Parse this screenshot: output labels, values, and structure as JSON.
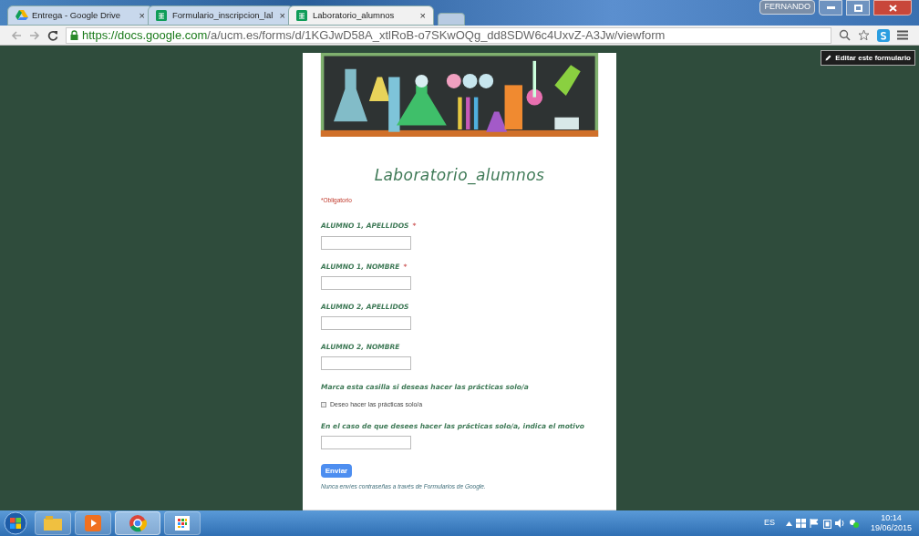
{
  "browser": {
    "tabs": [
      {
        "title": "Entrega - Google Drive",
        "selected": false,
        "close": "×"
      },
      {
        "title": "Formulario_inscripcion_lal",
        "selected": false,
        "close": "×"
      },
      {
        "title": "Laboratorio_alumnos",
        "selected": true,
        "close": "×"
      }
    ],
    "user": "FERNANDO",
    "url": {
      "host": "https://docs.google.com",
      "path": "/a/ucm.es/forms/d/1KGJwD58A_xtlRoB-o7SKwOQg_dd8SDW6c4UxvZ-A3Jw/viewform"
    }
  },
  "edit_button": "Editar este formulario",
  "form": {
    "title": "Laboratorio_alumnos",
    "required_note": "*Obligatorio",
    "required_mark": "*",
    "questions": [
      {
        "kind": "text",
        "label": "ALUMNO 1, APELLIDOS",
        "required": true
      },
      {
        "kind": "text",
        "label": "ALUMNO 1, NOMBRE",
        "required": true
      },
      {
        "kind": "text",
        "label": "ALUMNO 2, APELLIDOS",
        "required": false
      },
      {
        "kind": "text",
        "label": "ALUMNO 2, NOMBRE",
        "required": false
      },
      {
        "kind": "checkbox",
        "label": "Marca esta casilla si deseas hacer las prácticas solo/a",
        "required": false,
        "option": {
          "label": "Deseo hacer las prácticas solo/a",
          "checked": false
        }
      },
      {
        "kind": "text",
        "label": "En el caso de que desees hacer las prácticas solo/a, indica el motivo",
        "required": false
      }
    ],
    "submit": "Enviar",
    "footer_note": "Nunca envíes contraseñas a través de Formularios de Google."
  },
  "taskbar": {
    "language": "ES",
    "time": "10:14",
    "date": "19/06/2015"
  }
}
